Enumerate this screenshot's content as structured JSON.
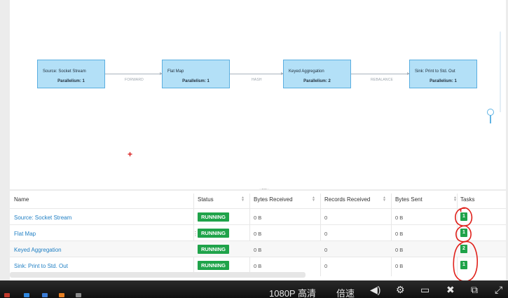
{
  "graph": {
    "nodes": [
      {
        "name": "Source: Socket Stream",
        "parallelism": "Parallelism: 1"
      },
      {
        "name": "Flat Map",
        "parallelism": "Parallelism: 1"
      },
      {
        "name": "Keyed Aggregation",
        "parallelism": "Parallelism: 2"
      },
      {
        "name": "Sink: Print to Std. Out",
        "parallelism": "Parallelism: 1"
      }
    ],
    "edges": [
      "FORWARD",
      "HASH",
      "REBALANCE"
    ]
  },
  "table": {
    "headers": [
      "Name",
      "Status",
      "Bytes Received",
      "Records Received",
      "Bytes Sent",
      "Tasks"
    ],
    "rows": [
      {
        "name": "Source: Socket Stream",
        "status": "RUNNING",
        "bytes_received": "0 B",
        "records_received": "0",
        "bytes_sent": "0 B",
        "tasks": "1"
      },
      {
        "name": "Flat Map",
        "status": "RUNNING",
        "bytes_received": "0 B",
        "records_received": "0",
        "bytes_sent": "0 B",
        "tasks": "1"
      },
      {
        "name": "Keyed Aggregation",
        "status": "RUNNING",
        "bytes_received": "0 B",
        "records_received": "0",
        "bytes_sent": "0 B",
        "tasks": "2"
      },
      {
        "name": "Sink: Print to Std. Out",
        "status": "RUNNING",
        "bytes_received": "0 B",
        "records_received": "0",
        "bytes_sent": "0 B",
        "tasks": "1"
      }
    ]
  },
  "player": {
    "quality": "1080P 高清",
    "speed": "倍速"
  },
  "colors": {
    "node_fill": "#b3e0f7",
    "node_border": "#5aaee0",
    "running": "#1fa34a",
    "link": "#1f7fc4",
    "annotation": "#e0201a"
  }
}
